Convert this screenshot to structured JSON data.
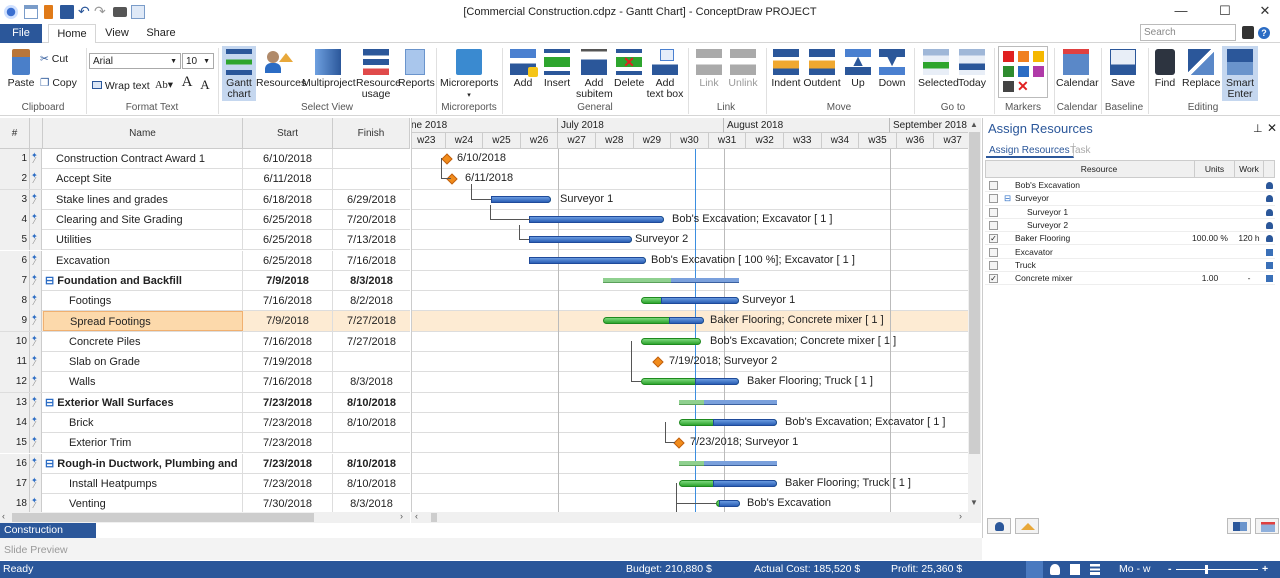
{
  "window": {
    "title": "[Commercial Construction.cdpz - Gantt Chart] - ConceptDraw PROJECT",
    "minimize": "—",
    "maximize": "☐",
    "close": "✕"
  },
  "tabs": {
    "file": "File",
    "home": "Home",
    "view": "View",
    "share": "Share"
  },
  "search": {
    "placeholder": "Search"
  },
  "ribbon": {
    "paste": "Paste",
    "cut": "Cut",
    "copy": "Copy",
    "clipboard_group": "Clipboard",
    "font_name": "Arial",
    "font_size": "10",
    "wrap_text": "Wrap text",
    "ab": "Ab",
    "format_text_group": "Format Text",
    "gantt_chart": "Gantt chart",
    "resources": "Resources",
    "multiproject": "Multiproject",
    "resource_usage": "Resource usage",
    "reports": "Reports",
    "select_view_group": "Select View",
    "microreports": "Microreports",
    "microreports_group": "Microreports",
    "add": "Add",
    "insert": "Insert",
    "add_subitem": "Add subitem",
    "delete": "Delete",
    "add_text_box": "Add text box",
    "general_group": "General",
    "link": "Link",
    "unlink": "Unlink",
    "link_group": "Link",
    "indent": "Indent",
    "outdent": "Outdent",
    "up": "Up",
    "down": "Down",
    "move_group": "Move",
    "selected": "Selected",
    "today": "Today",
    "goto_group": "Go to",
    "markers_group": "Markers",
    "calendar": "Calendar",
    "calendar_group": "Calendar",
    "save": "Save",
    "baseline_group": "Baseline",
    "find": "Find",
    "replace": "Replace",
    "smart_enter": "Smart Enter",
    "editing_group": "Editing"
  },
  "grid": {
    "headers": {
      "num": "#",
      "name": "Name",
      "start": "Start",
      "finish": "Finish"
    },
    "rows": [
      {
        "n": "1",
        "name": "Construction Contract Award 1",
        "start": "6/10/2018",
        "finish": ""
      },
      {
        "n": "2",
        "name": "Accept Site",
        "start": "6/11/2018",
        "finish": ""
      },
      {
        "n": "3",
        "name": "Stake lines and grades",
        "start": "6/18/2018",
        "finish": "6/29/2018"
      },
      {
        "n": "4",
        "name": "Clearing and Site Grading",
        "start": "6/25/2018",
        "finish": "7/20/2018"
      },
      {
        "n": "5",
        "name": "Utilities",
        "start": "6/25/2018",
        "finish": "7/13/2018"
      },
      {
        "n": "6",
        "name": "Excavation",
        "start": "6/25/2018",
        "finish": "7/16/2018"
      },
      {
        "n": "7",
        "name": "Foundation and Backfill",
        "start": "7/9/2018",
        "finish": "8/3/2018"
      },
      {
        "n": "8",
        "name": "Footings",
        "start": "7/16/2018",
        "finish": "8/2/2018"
      },
      {
        "n": "9",
        "name": "Spread Footings",
        "start": "7/9/2018",
        "finish": "7/27/2018"
      },
      {
        "n": "10",
        "name": "Concrete Piles",
        "start": "7/16/2018",
        "finish": "7/27/2018"
      },
      {
        "n": "11",
        "name": "Slab on Grade",
        "start": "7/19/2018",
        "finish": ""
      },
      {
        "n": "12",
        "name": "Walls",
        "start": "7/16/2018",
        "finish": "8/3/2018"
      },
      {
        "n": "13",
        "name": "Exterior Wall Surfaces",
        "start": "7/23/2018",
        "finish": "8/10/2018"
      },
      {
        "n": "14",
        "name": "Brick",
        "start": "7/23/2018",
        "finish": "8/10/2018"
      },
      {
        "n": "15",
        "name": "Exterior Trim",
        "start": "7/23/2018",
        "finish": ""
      },
      {
        "n": "16",
        "name": "Rough-in Ductwork, Plumbing and",
        "start": "7/23/2018",
        "finish": "8/10/2018"
      },
      {
        "n": "17",
        "name": "Install Heatpumps",
        "start": "7/23/2018",
        "finish": "8/10/2018"
      },
      {
        "n": "18",
        "name": "Venting",
        "start": "7/30/2018",
        "finish": "8/3/2018"
      }
    ]
  },
  "gantt": {
    "months": [
      "ne 2018",
      "July 2018",
      "August 2018",
      "September 2018"
    ],
    "weeks": [
      "w23",
      "w24",
      "w25",
      "w26",
      "w27",
      "w28",
      "w29",
      "w30",
      "w31",
      "w32",
      "w33",
      "w34",
      "w35",
      "w36",
      "w37"
    ],
    "labels": {
      "r1": "6/10/2018",
      "r2": "6/11/2018",
      "r3": "Surveyor 1",
      "r4": "Bob's Excavation; Excavator [ 1 ]",
      "r5": "Surveyor 2",
      "r6": "Bob's Excavation [ 100 %]; Excavator [ 1 ]",
      "r8": "Surveyor 1",
      "r9": "Baker Flooring; Concrete mixer [ 1 ]",
      "r10": "Bob's Excavation; Concrete mixer [ 1 ]",
      "r11": "7/19/2018; Surveyor 2",
      "r12": "Baker Flooring; Truck [ 1 ]",
      "r14": "Bob's Excavation; Excavator [ 1 ]",
      "r15": "7/23/2018; Surveyor 1",
      "r17": "Baker Flooring; Truck [ 1 ]",
      "r18": "Bob's Excavation"
    }
  },
  "panel": {
    "title": "Assign Resources",
    "tab_assign": "Assign Resources",
    "tab_task": "Task",
    "headers": {
      "resource": "Resource",
      "units": "Units",
      "work": "Work"
    },
    "rows": [
      {
        "name": "Bob's Excavation",
        "units": "",
        "work": "",
        "checked": false
      },
      {
        "name": "Surveyor",
        "units": "",
        "work": "",
        "checked": false
      },
      {
        "name": "Surveyor 1",
        "units": "",
        "work": "",
        "checked": false
      },
      {
        "name": "Surveyor 2",
        "units": "",
        "work": "",
        "checked": false
      },
      {
        "name": "Baker Flooring",
        "units": "100.00 %",
        "work": "120 h",
        "checked": true
      },
      {
        "name": "Excavator",
        "units": "",
        "work": "",
        "checked": false
      },
      {
        "name": "Truck",
        "units": "",
        "work": "",
        "checked": false
      },
      {
        "name": "Concrete mixer",
        "units": "1.00",
        "work": "-",
        "checked": true
      }
    ]
  },
  "bottom": {
    "project_tab": "Construction Project",
    "slide_preview": "Slide Preview"
  },
  "status": {
    "ready": "Ready",
    "budget": "Budget: 210,880 $",
    "actual_cost": "Actual Cost: 185,520 $",
    "profit": "Profit: 25,360 $",
    "zoom_scale": "Mo - w"
  }
}
